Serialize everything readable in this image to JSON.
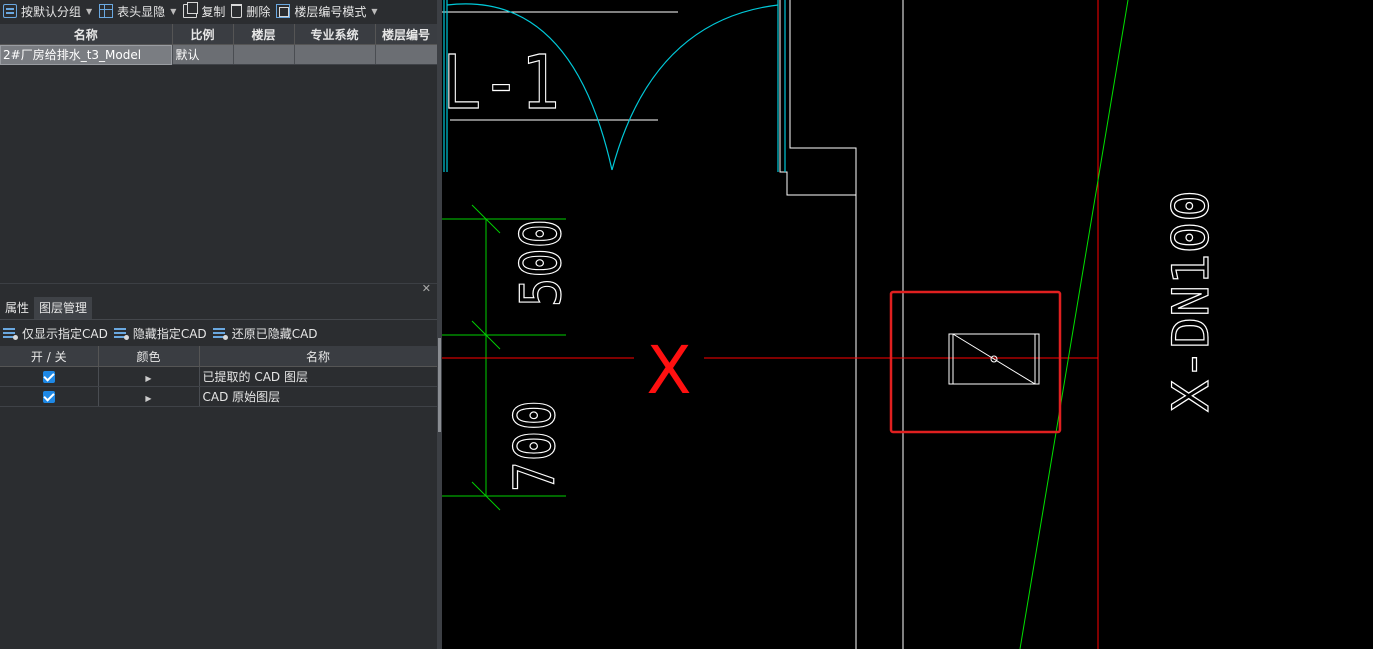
{
  "top_toolbar": {
    "group_default": "按默认分组",
    "toggle_header": "表头显隐",
    "copy": "复制",
    "delete": "删除",
    "floor_number_mode": "楼层编号模式"
  },
  "model_table": {
    "headers": [
      "名称",
      "比例",
      "楼层",
      "专业系统",
      "楼层编号"
    ],
    "rows": [
      {
        "name": "2#厂房给排水_t3_Model",
        "scale": "默认",
        "floor": "",
        "system": "",
        "floor_number": ""
      }
    ]
  },
  "panel": {
    "tabs": [
      "属性",
      "图层管理"
    ],
    "active_tab": "图层管理",
    "close_glyph": "✕"
  },
  "layer_toolbar": {
    "show_only": "仅显示指定CAD",
    "hide": "隐藏指定CAD",
    "restore": "还原已隐藏CAD"
  },
  "layer_table": {
    "headers": [
      "开 / 关",
      "颜色",
      "名称"
    ],
    "rows": [
      {
        "on": true,
        "name": "已提取的 CAD 图层"
      },
      {
        "on": true,
        "name": "CAD 原始图层"
      }
    ]
  },
  "cad": {
    "label_pipe": "X-DN100",
    "label_room": "L-1",
    "dim_top": "500",
    "dim_bottom": "700",
    "marker": "X",
    "colors": {
      "background": "#000000",
      "wall": "#ffffff",
      "door": "#00c8d8",
      "dimension": "#00d000",
      "axis": "#ff0000",
      "highlight": "#e02020",
      "pipe_line": "#00e000"
    }
  }
}
